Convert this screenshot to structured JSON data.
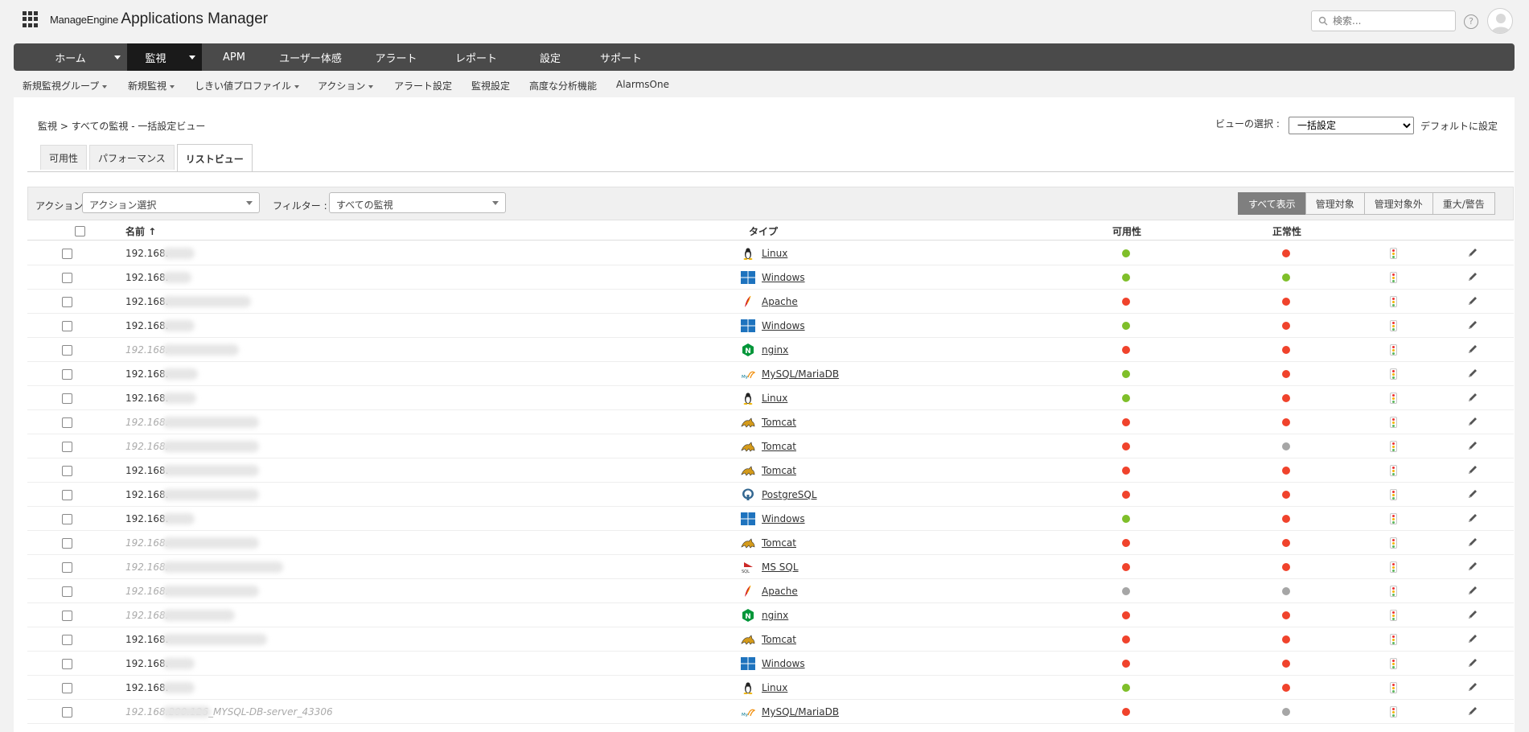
{
  "header": {
    "brand_small": "ManageEngine",
    "brand_large": "Applications Manager",
    "search_placeholder": "検索...",
    "help": "?"
  },
  "main_nav": [
    {
      "label": "ホーム",
      "active": false,
      "dropdown": true
    },
    {
      "label": "監視",
      "active": true,
      "dropdown": true
    },
    {
      "label": "APM",
      "active": false,
      "dropdown": false
    },
    {
      "label": "ユーザー体感",
      "active": false,
      "dropdown": false
    },
    {
      "label": "アラート",
      "active": false,
      "dropdown": false
    },
    {
      "label": "レポート",
      "active": false,
      "dropdown": false
    },
    {
      "label": "設定",
      "active": false,
      "dropdown": false
    },
    {
      "label": "サポート",
      "active": false,
      "dropdown": false
    }
  ],
  "sub_nav": [
    {
      "label": "新規監視グループ",
      "dropdown": true
    },
    {
      "label": "新規監視",
      "dropdown": true
    },
    {
      "label": "しきい値プロファイル",
      "dropdown": true
    },
    {
      "label": "アクション",
      "dropdown": true
    },
    {
      "label": "アラート設定",
      "dropdown": false
    },
    {
      "label": "監視設定",
      "dropdown": false
    },
    {
      "label": "高度な分析機能",
      "dropdown": false
    },
    {
      "label": "AlarmsOne",
      "dropdown": false
    }
  ],
  "breadcrumb": {
    "root": "監視",
    "sep": " > ",
    "current": "すべての監視 - 一括設定ビュー"
  },
  "view_select": {
    "label": "ビューの選択 :",
    "value": "一括設定",
    "default_link": "デフォルトに設定"
  },
  "tabs": [
    {
      "label": "可用性",
      "active": false
    },
    {
      "label": "パフォーマンス",
      "active": false
    },
    {
      "label": "リストビュー",
      "active": true
    }
  ],
  "filter_bar": {
    "action_label": "アクション :",
    "action_value": "アクション選択",
    "filter_label": "フィルター :",
    "filter_value": "すべての監視",
    "buttons": [
      {
        "label": "すべて表示",
        "active": true
      },
      {
        "label": "管理対象",
        "active": false
      },
      {
        "label": "管理対象外",
        "active": false
      },
      {
        "label": "重大/警告",
        "active": false
      }
    ]
  },
  "table": {
    "columns": {
      "name": "名前",
      "sort": "↑",
      "type": "タイプ",
      "availability": "可用性",
      "health": "正常性"
    },
    "rows": [
      {
        "name": "192.168.",
        "unmanaged": false,
        "type": "Linux",
        "icon": "linux-icon",
        "avail": "green",
        "health": "red"
      },
      {
        "name": "192.168.",
        "unmanaged": false,
        "type": "Windows",
        "icon": "windows-icon",
        "avail": "green",
        "health": "green"
      },
      {
        "name": "192.168.",
        "unmanaged": false,
        "type": "Apache",
        "icon": "apache-icon",
        "avail": "red",
        "health": "red"
      },
      {
        "name": "192.168.",
        "unmanaged": false,
        "type": "Windows",
        "icon": "windows-icon",
        "avail": "green",
        "health": "red"
      },
      {
        "name": "192.168.",
        "unmanaged": true,
        "type": "nginx",
        "icon": "nginx-icon",
        "avail": "red",
        "health": "red"
      },
      {
        "name": "192.168.",
        "unmanaged": false,
        "type": "MySQL/MariaDB",
        "icon": "mysql-icon",
        "avail": "green",
        "health": "red"
      },
      {
        "name": "192.168.",
        "unmanaged": false,
        "type": "Linux",
        "icon": "linux-icon",
        "avail": "green",
        "health": "red"
      },
      {
        "name": "192.168.",
        "unmanaged": true,
        "type": "Tomcat",
        "icon": "tomcat-icon",
        "avail": "red",
        "health": "red"
      },
      {
        "name": "192.168.",
        "unmanaged": true,
        "type": "Tomcat",
        "icon": "tomcat-icon",
        "avail": "red",
        "health": "gray"
      },
      {
        "name": "192.168.",
        "unmanaged": false,
        "type": "Tomcat",
        "icon": "tomcat-icon",
        "avail": "red",
        "health": "red"
      },
      {
        "name": "192.168.",
        "unmanaged": false,
        "type": "PostgreSQL",
        "icon": "postgresql-icon",
        "avail": "red",
        "health": "red"
      },
      {
        "name": "192.168.",
        "unmanaged": false,
        "type": "Windows",
        "icon": "windows-icon",
        "avail": "green",
        "health": "red"
      },
      {
        "name": "192.168.",
        "unmanaged": true,
        "type": "Tomcat",
        "icon": "tomcat-icon",
        "avail": "red",
        "health": "red"
      },
      {
        "name": "192.168.",
        "unmanaged": true,
        "type": "MS SQL",
        "icon": "mssql-icon",
        "avail": "red",
        "health": "red"
      },
      {
        "name": "192.168.",
        "unmanaged": true,
        "type": "Apache",
        "icon": "apache-icon",
        "avail": "gray",
        "health": "gray"
      },
      {
        "name": "192.168.",
        "unmanaged": true,
        "type": "nginx",
        "icon": "nginx-icon",
        "avail": "red",
        "health": "red"
      },
      {
        "name": "192.168.",
        "unmanaged": false,
        "type": "Tomcat",
        "icon": "tomcat-icon",
        "avail": "red",
        "health": "red"
      },
      {
        "name": "192.168.",
        "unmanaged": false,
        "type": "Windows",
        "icon": "windows-icon",
        "avail": "red",
        "health": "red"
      },
      {
        "name": "192.168.",
        "unmanaged": false,
        "type": "Linux",
        "icon": "linux-icon",
        "avail": "green",
        "health": "red"
      },
      {
        "name": "192.168.200.126_MYSQL-DB-server_43306",
        "unmanaged": true,
        "type": "MySQL/MariaDB",
        "icon": "mysql-icon",
        "avail": "red",
        "health": "gray"
      }
    ]
  }
}
